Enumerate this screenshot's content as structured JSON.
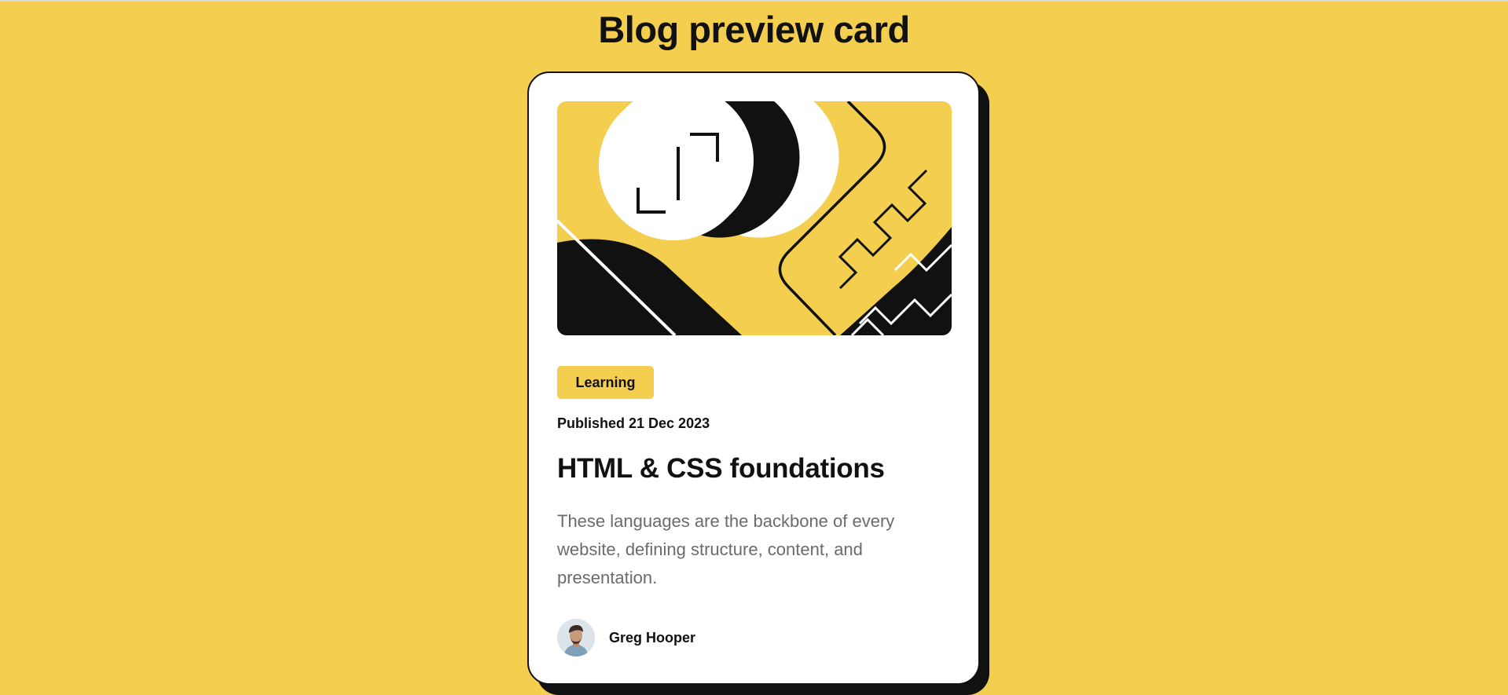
{
  "page": {
    "title": "Blog preview card"
  },
  "card": {
    "tag": "Learning",
    "published": "Published 21 Dec 2023",
    "title": "HTML & CSS foundations",
    "excerpt": "These languages are the backbone of every website, defining structure, content, and presentation.",
    "author": {
      "name": "Greg Hooper",
      "avatar_icon": "avatar-portrait"
    },
    "illustration_icon": "abstract-illustration"
  },
  "colors": {
    "background": "#F4CE4E",
    "card": "#FFFFFF",
    "text": "#111111",
    "muted_text": "#6B6B6B"
  }
}
